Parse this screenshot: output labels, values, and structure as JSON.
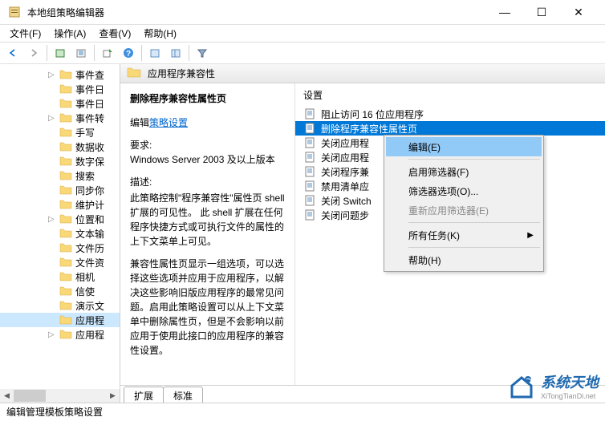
{
  "window": {
    "title": "本地组策略编辑器",
    "minimize": "—",
    "maximize": "☐",
    "close": "✕"
  },
  "menu": {
    "file": "文件(F)",
    "action": "操作(A)",
    "view": "查看(V)",
    "help": "帮助(H)"
  },
  "tree": {
    "items": [
      {
        "label": "事件查",
        "expand": "▷"
      },
      {
        "label": "事件日",
        "expand": ""
      },
      {
        "label": "事件日",
        "expand": ""
      },
      {
        "label": "事件转",
        "expand": "▷"
      },
      {
        "label": "手写",
        "expand": ""
      },
      {
        "label": "数据收",
        "expand": ""
      },
      {
        "label": "数字保",
        "expand": ""
      },
      {
        "label": "搜索",
        "expand": ""
      },
      {
        "label": "同步你",
        "expand": ""
      },
      {
        "label": "维护计",
        "expand": ""
      },
      {
        "label": "位置和",
        "expand": "▷"
      },
      {
        "label": "文本输",
        "expand": ""
      },
      {
        "label": "文件历",
        "expand": ""
      },
      {
        "label": "文件资",
        "expand": ""
      },
      {
        "label": "相机",
        "expand": ""
      },
      {
        "label": "信使",
        "expand": ""
      },
      {
        "label": "演示文",
        "expand": ""
      },
      {
        "label": "应用程",
        "expand": "",
        "selected": true
      },
      {
        "label": "应用程",
        "expand": "▷"
      }
    ]
  },
  "header": {
    "title": "应用程序兼容性"
  },
  "detail": {
    "subtitle": "删除程序兼容性属性页",
    "edit_prefix": "编辑",
    "edit_link": "策略设置",
    "req_label": "要求:",
    "req_value": "Windows Server 2003 及以上版本",
    "desc_label": "描述:",
    "desc_p1": "此策略控制\"程序兼容性\"属性页 shell 扩展的可见性。 此 shell 扩展在任何程序快捷方式或可执行文件的属性的上下文菜单上可见。",
    "desc_p2": "兼容性属性页显示一组选项，可以选择这些选项并应用于应用程序，以解决这些影响旧版应用程序的最常见问题。启用此策略设置可以从上下文菜单中删除属性页，但是不会影响以前应用于使用此接口的应用程序的兼容性设置。"
  },
  "settings": {
    "label": "设置",
    "items": [
      {
        "label": "阻止访问 16 位应用程序"
      },
      {
        "label": "删除程序兼容性属性页",
        "selected": true
      },
      {
        "label": "关闭应用程"
      },
      {
        "label": "关闭应用程"
      },
      {
        "label": "关闭程序兼"
      },
      {
        "label": "禁用清单应"
      },
      {
        "label": "关闭 Switch"
      },
      {
        "label": "关闭问题步"
      }
    ]
  },
  "tabs": {
    "ext": "扩展",
    "std": "标准"
  },
  "context": {
    "edit": "编辑(E)",
    "filter_on": "启用筛选器(F)",
    "filter_opts": "筛选器选项(O)...",
    "filter_reapply": "重新应用筛选器(E)",
    "all_tasks": "所有任务(K)",
    "help": "帮助(H)"
  },
  "statusbar": {
    "text": "编辑管理模板策略设置"
  },
  "watermark": {
    "text": "系统天地",
    "url": "XiTongTianDi.net"
  }
}
